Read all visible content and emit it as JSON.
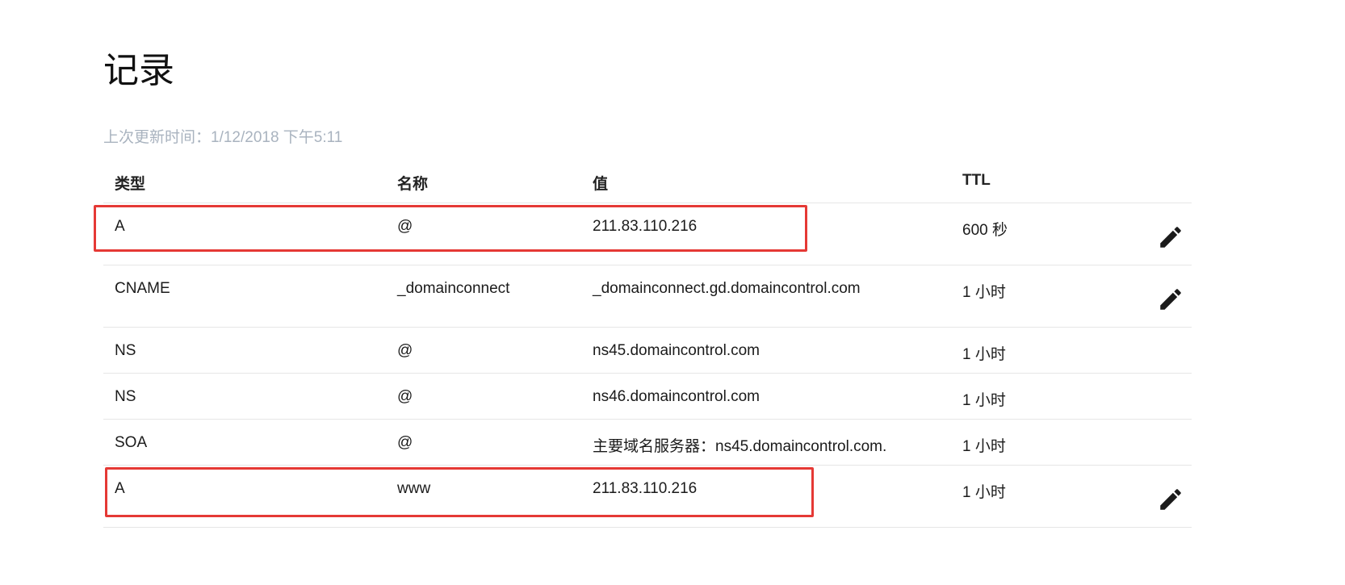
{
  "page": {
    "title": "记录",
    "last_updated": "上次更新时间：1/12/2018 下午5:11"
  },
  "table": {
    "headers": {
      "type": "类型",
      "name": "名称",
      "value": "值",
      "ttl": "TTL"
    },
    "rows": [
      {
        "type": "A",
        "name": "@",
        "value": "211.83.110.216",
        "ttl": "600 秒",
        "editable": true,
        "highlighted": true
      },
      {
        "type": "CNAME",
        "name": "_domainconnect",
        "value": "_domainconnect.gd.domaincontrol.com",
        "ttl": "1 小时",
        "editable": true,
        "highlighted": false
      },
      {
        "type": "NS",
        "name": "@",
        "value": "ns45.domaincontrol.com",
        "ttl": "1 小时",
        "editable": false,
        "highlighted": false
      },
      {
        "type": "NS",
        "name": "@",
        "value": "ns46.domaincontrol.com",
        "ttl": "1 小时",
        "editable": false,
        "highlighted": false
      },
      {
        "type": "SOA",
        "name": "@",
        "value": "主要域名服务器：ns45.domaincontrol.com.",
        "ttl": "1 小时",
        "editable": false,
        "highlighted": false
      },
      {
        "type": "A",
        "name": "www",
        "value": "211.83.110.216",
        "ttl": "1 小时",
        "editable": true,
        "highlighted": true
      }
    ]
  },
  "icons": {
    "edit": "pencil-icon"
  },
  "colors": {
    "highlight": "#e53935",
    "muted_text": "#a9b3bf",
    "divider": "#e6e6e6"
  }
}
